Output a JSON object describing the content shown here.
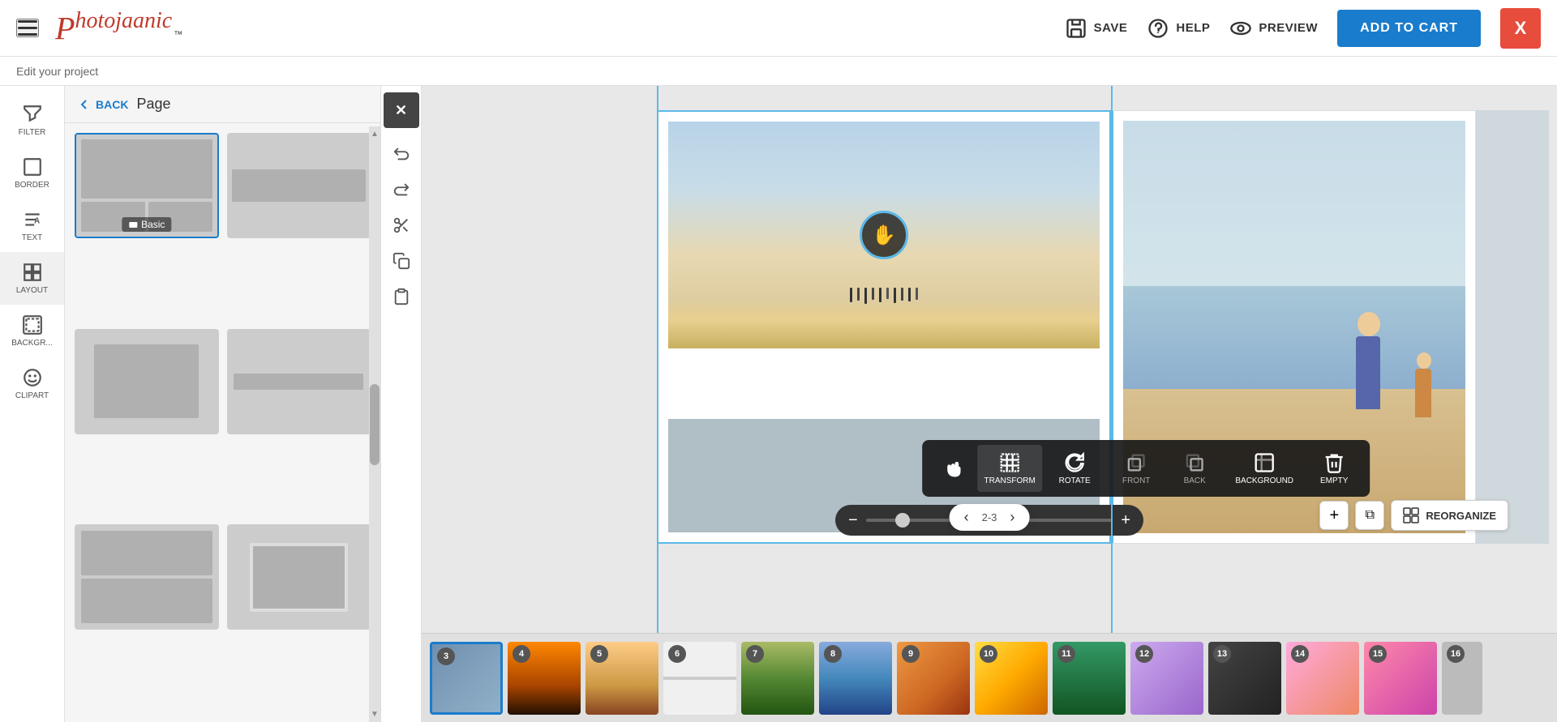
{
  "app": {
    "logo": "Photojaanic",
    "tagline": "™",
    "subtitle": "Edit your project"
  },
  "navbar": {
    "save_label": "SAVE",
    "help_label": "HELP",
    "preview_label": "PREVIEW",
    "add_to_cart_label": "ADD TO CART",
    "close_label": "X"
  },
  "sidebar": {
    "items": [
      {
        "id": "filter",
        "label": "FILTER"
      },
      {
        "id": "border",
        "label": "BORDER"
      },
      {
        "id": "text",
        "label": "TEXT"
      },
      {
        "id": "layout",
        "label": "LAYOUT"
      },
      {
        "id": "background",
        "label": "BACKGR..."
      },
      {
        "id": "clipart",
        "label": "CLIPART"
      }
    ]
  },
  "panel": {
    "back_label": "BACK",
    "title": "Page",
    "layouts": [
      {
        "id": "layout-1",
        "label": "Basic",
        "active": true
      },
      {
        "id": "layout-2",
        "label": ""
      },
      {
        "id": "layout-3",
        "label": ""
      },
      {
        "id": "layout-4",
        "label": ""
      },
      {
        "id": "layout-5",
        "label": ""
      },
      {
        "id": "layout-6",
        "label": ""
      }
    ]
  },
  "tools": {
    "undo_label": "undo",
    "redo_label": "redo",
    "cut_label": "cut",
    "copy_label": "copy",
    "paste_label": "paste"
  },
  "canvas": {
    "page_num": "2-3",
    "zoom_value": 15
  },
  "toolbar": {
    "hand_label": "",
    "transform_label": "TRANSFORM",
    "rotate_label": "ROTATE",
    "front_label": "FRONT",
    "back_label": "BACK",
    "background_label": "BACKGROUND",
    "empty_label": "EMPTY"
  },
  "reorganize_label": "REORGANIZE",
  "filmstrip": {
    "thumbs": [
      {
        "num": "3",
        "active": true,
        "color": "active-blue"
      },
      {
        "num": "4",
        "color": "ft-sunrise"
      },
      {
        "num": "5",
        "color": "ft-beach"
      },
      {
        "num": "6",
        "color": "ft-white"
      },
      {
        "num": "7",
        "color": "ft-green"
      },
      {
        "num": "8",
        "color": "ft-kid"
      },
      {
        "num": "9",
        "color": "ft-kid2"
      },
      {
        "num": "10",
        "color": "ft-party"
      },
      {
        "num": "11",
        "color": "ft-teal"
      },
      {
        "num": "12",
        "color": "ft-pink"
      },
      {
        "num": "13",
        "color": "ft-dark"
      },
      {
        "num": "14",
        "color": "ft-party2"
      },
      {
        "num": "15",
        "color": "ft-party3"
      },
      {
        "num": "16",
        "color": "ft-half"
      }
    ]
  }
}
